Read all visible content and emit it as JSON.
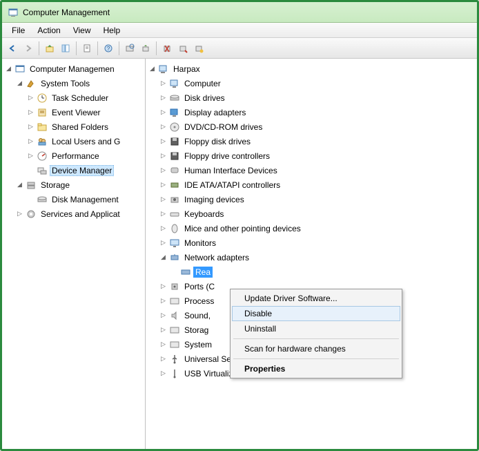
{
  "window": {
    "title": "Computer Management"
  },
  "menubar": {
    "file": "File",
    "action": "Action",
    "view": "View",
    "help": "Help"
  },
  "left_tree": {
    "root": "Computer Managemen",
    "system_tools": {
      "label": "System Tools",
      "items": [
        "Task Scheduler",
        "Event Viewer",
        "Shared Folders",
        "Local Users and G",
        "Performance",
        "Device Manager"
      ]
    },
    "storage": {
      "label": "Storage",
      "items": [
        "Disk Management"
      ]
    },
    "services": "Services and Applicat"
  },
  "device_tree": {
    "root": "Harpax",
    "categories": [
      "Computer",
      "Disk drives",
      "Display adapters",
      "DVD/CD-ROM drives",
      "Floppy disk drives",
      "Floppy drive controllers",
      "Human Interface Devices",
      "IDE ATA/ATAPI controllers",
      "Imaging devices",
      "Keyboards",
      "Mice and other pointing devices",
      "Monitors"
    ],
    "network": {
      "label": "Network adapters",
      "selected_device": "Rea"
    },
    "after": [
      "Ports (C",
      "Process",
      "Sound,",
      "Storag",
      "System",
      "Universal Serial Bus controllers",
      "USB Virtualization"
    ]
  },
  "context_menu": {
    "update": "Update Driver Software...",
    "disable": "Disable",
    "uninstall": "Uninstall",
    "scan": "Scan for hardware changes",
    "properties": "Properties"
  }
}
